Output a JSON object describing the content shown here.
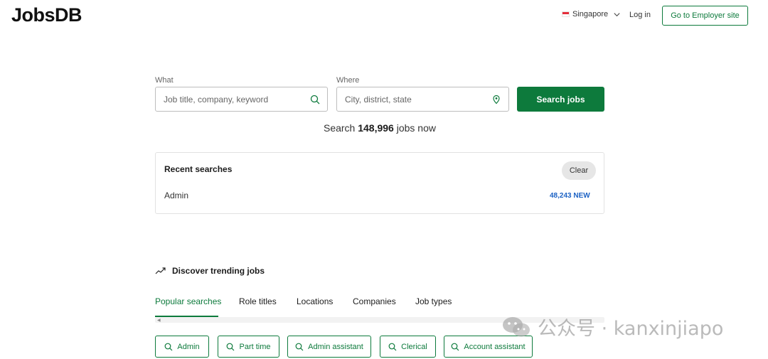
{
  "header": {
    "logo": "JobsDB",
    "region": "Singapore",
    "login": "Log in",
    "employer_button": "Go to Employer site"
  },
  "search": {
    "what_label": "What",
    "what_placeholder": "Job title, company, keyword",
    "where_label": "Where",
    "where_placeholder": "City, district, state",
    "button": "Search jobs",
    "count_prefix": "Search",
    "count": "148,996",
    "count_suffix": "jobs now"
  },
  "recent": {
    "title": "Recent searches",
    "clear": "Clear",
    "items": [
      {
        "term": "Admin",
        "count": "48,243 NEW"
      }
    ]
  },
  "trending": {
    "title": "Discover trending jobs",
    "tabs": [
      {
        "label": "Popular searches",
        "active": true
      },
      {
        "label": "Role titles",
        "active": false
      },
      {
        "label": "Locations",
        "active": false
      },
      {
        "label": "Companies",
        "active": false
      },
      {
        "label": "Job types",
        "active": false
      }
    ],
    "chips": [
      "Admin",
      "Part time",
      "Admin assistant",
      "Clerical",
      "Account assistant"
    ]
  },
  "watermark": "公众号 · kanxinjiapo",
  "colors": {
    "brand_green": "#0d7a3c",
    "link_blue": "#1c62c4"
  },
  "icons": [
    "search-icon",
    "location-pin-icon",
    "chevron-down-icon",
    "trending-icon",
    "singapore-flag-icon",
    "wechat-icon"
  ]
}
